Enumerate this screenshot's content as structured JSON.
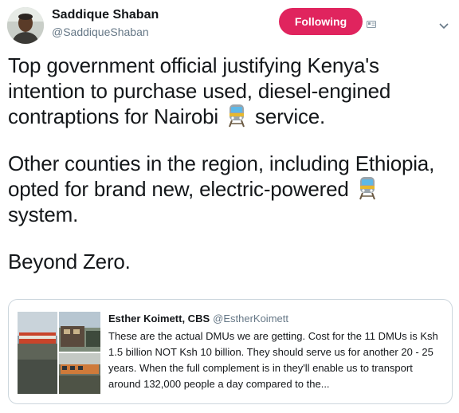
{
  "author": {
    "name": "Saddique Shaban",
    "handle": "@SaddiqueShaban"
  },
  "follow_button": {
    "label": "Following"
  },
  "tweet": {
    "paragraphs": [
      {
        "before": "Top government official justifying Kenya's intention to purchase used, diesel-engined contraptions for Nairobi",
        "emoji": "train-emoji",
        "after": " service."
      },
      {
        "before": "Other counties in the region,  including Ethiopia,  opted for brand new,  electric-powered",
        "emoji": "train-emoji",
        "after": " system."
      },
      {
        "before": "Beyond Zero.",
        "emoji": null,
        "after": ""
      }
    ]
  },
  "quoted_tweet": {
    "name": "Esther Koimett, CBS",
    "handle": "@EstherKoimett",
    "text": "These are the actual DMUs we are getting. Cost for the 11 DMUs is Ksh 1.5 billion NOT Ksh 10 billion. They should serve us for another 20 - 25 years. When the full complement is in they'll enable us to transport around 132,000 people a day compared to the..."
  },
  "colors": {
    "follow_bg": "#e0245e",
    "handle": "#657786",
    "border": "#ccd6dd",
    "text": "#14171a"
  }
}
